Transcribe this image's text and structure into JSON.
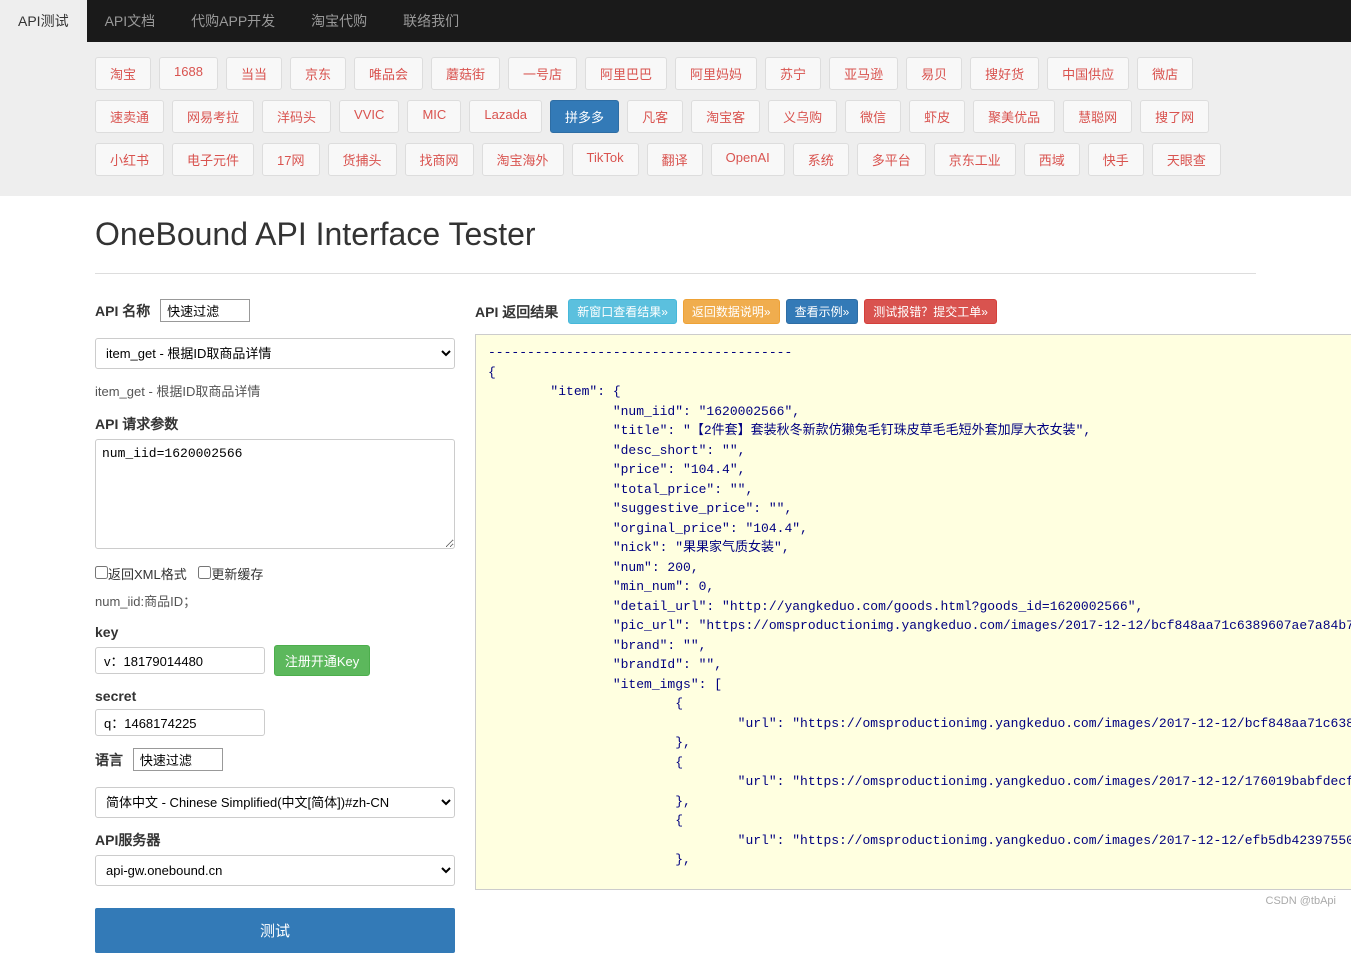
{
  "topNav": [
    {
      "label": "API测试",
      "active": true
    },
    {
      "label": "API文档"
    },
    {
      "label": "代购APP开发"
    },
    {
      "label": "淘宝代购"
    },
    {
      "label": "联络我们"
    }
  ],
  "platforms": {
    "row1": [
      "淘宝",
      "1688",
      "当当",
      "京东",
      "唯品会",
      "蘑菇街",
      "一号店",
      "阿里巴巴",
      "阿里妈妈",
      "苏宁",
      "亚马逊",
      "易贝",
      "搜好货",
      "中国供应",
      "微店"
    ],
    "row2": [
      "速卖通",
      "网易考拉",
      "洋码头",
      "VVIC",
      "MIC",
      "Lazada",
      "拼多多",
      "凡客",
      "淘宝客",
      "义乌购",
      "微信",
      "虾皮",
      "聚美优品",
      "慧聪网",
      "搜了网"
    ],
    "row3": [
      "小红书",
      "电子元件",
      "17网",
      "货捕头",
      "找商网",
      "淘宝海外",
      "TikTok",
      "翻译",
      "OpenAI",
      "系统",
      "多平台",
      "京东工业",
      "西域",
      "快手",
      "天眼查"
    ],
    "active": "拼多多"
  },
  "pageTitle": "OneBound API Interface Tester",
  "form": {
    "apiNameLabel": "API 名称",
    "apiNameFilter": "快速过滤",
    "apiSelected": "item_get - 根据ID取商品详情",
    "apiDesc": "item_get - 根据ID取商品详情",
    "paramsLabel": "API 请求参数",
    "paramsValue": "num_iid=1620002566",
    "xmlLabel": "返回XML格式",
    "cacheLabel": "更新缓存",
    "paramHint": "num_iid:商品ID；",
    "keyLabel": "key",
    "keyValue": "v：18179014480",
    "registerBtn": "注册开通Key",
    "secretLabel": "secret",
    "secretValue": "q：1468174225",
    "langLabel": "语言",
    "langFilter": "快速过滤",
    "langSelected": "简体中文 - Chinese Simplified(中文[简体])#zh-CN",
    "serverLabel": "API服务器",
    "serverSelected": "api-gw.onebound.cn",
    "testBtn": "测试"
  },
  "result": {
    "label": "API 返回结果",
    "btn1": "新窗口查看结果»",
    "btn2": "返回数据说明»",
    "btn3": "查看示例»",
    "btn4": "测试报错？提交工单»",
    "json": "---------------------------------------\n{\n        \"item\": {\n                \"num_iid\": \"1620002566\",\n                \"title\": \"【2件套】套装秋冬新款仿獭兔毛钉珠皮草毛毛短外套加厚大衣女装\",\n                \"desc_short\": \"\",\n                \"price\": \"104.4\",\n                \"total_price\": \"\",\n                \"suggestive_price\": \"\",\n                \"orginal_price\": \"104.4\",\n                \"nick\": \"果果家气质女装\",\n                \"num\": 200,\n                \"min_num\": 0,\n                \"detail_url\": \"http://yangkeduo.com/goods.html?goods_id=1620002566\",\n                \"pic_url\": \"https://omsproductionimg.yangkeduo.com/images/2017-12-12/bcf848aa71c6389607ae7a84b70f1543.jpeg\",\n                \"brand\": \"\",\n                \"brandId\": \"\",\n                \"item_imgs\": [\n                        {\n                                \"url\": \"https://omsproductionimg.yangkeduo.com/images/2017-12-12/bcf848aa71c6389607ae7a84b70f1543.jpeg\"\n                        },\n                        {\n                                \"url\": \"https://omsproductionimg.yangkeduo.com/images/2017-12-12/176019babfdecffa1d9f98f40b7e99b4.jpeg\"\n                        },\n                        {\n                                \"url\": \"https://omsproductionimg.yangkeduo.com/images/2017-12-12/efb5db42397550bffd3211ca6f197498.jpeg\"\n                        },"
  },
  "watermark": "CSDN @tbApi"
}
